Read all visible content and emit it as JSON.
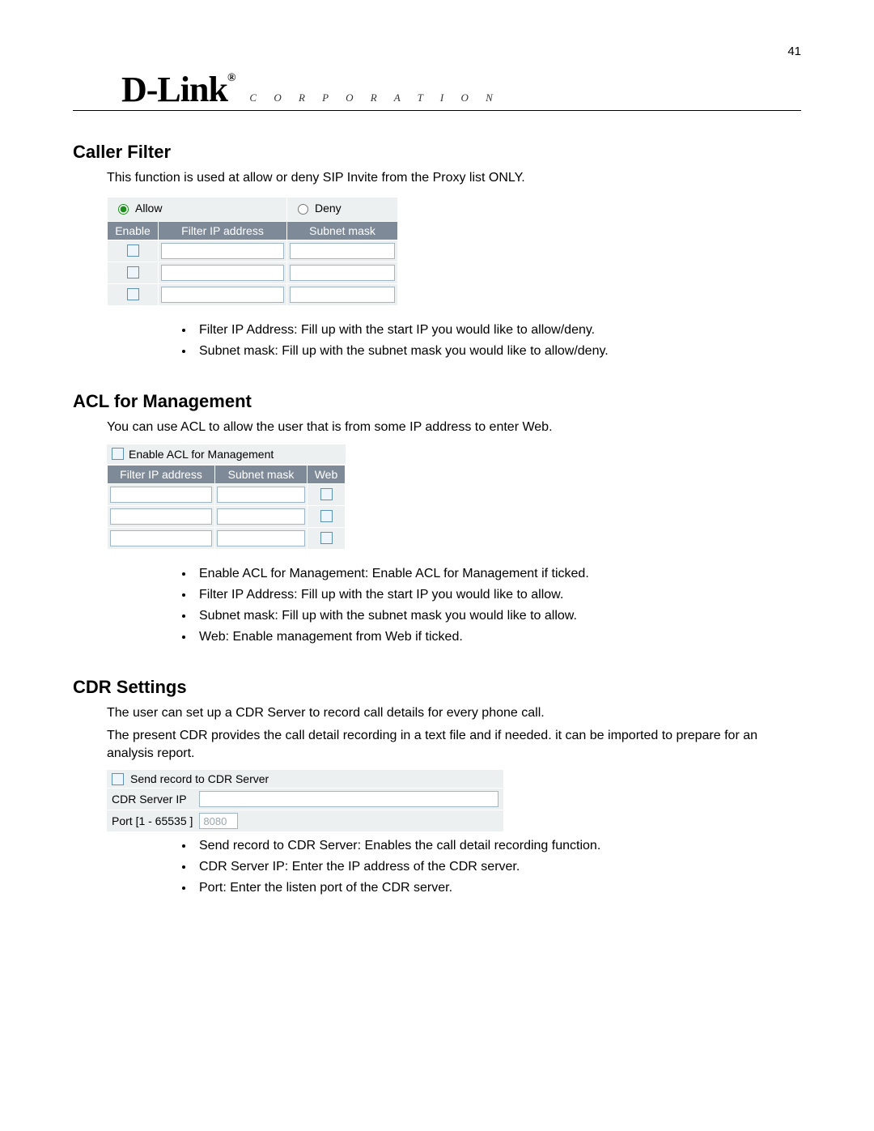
{
  "page_number": "41",
  "brand": {
    "name": "D-Link",
    "reg": "®",
    "tagline": "C O R P O R A T I O N"
  },
  "caller_filter": {
    "heading": "Caller Filter",
    "intro": "This function is used at allow or deny SIP Invite from the Proxy list ONLY.",
    "radio_allow": "Allow",
    "radio_deny": "Deny",
    "allow_selected": true,
    "col_enable": "Enable",
    "col_ip": "Filter IP address",
    "col_mask": "Subnet mask",
    "rows": [
      {
        "enable": false,
        "ip": "",
        "mask": ""
      },
      {
        "enable": false,
        "ip": "",
        "mask": ""
      },
      {
        "enable": false,
        "ip": "",
        "mask": ""
      }
    ],
    "bullets": [
      "Filter IP Address: Fill up with the start IP you would like to allow/deny.",
      "Subnet mask: Fill up with the subnet mask you would like to allow/deny."
    ]
  },
  "acl": {
    "heading": "ACL for Management",
    "intro": "You can use ACL to allow the user that is from some IP address to enter Web.",
    "enable_label": "Enable ACL for Management",
    "enable_checked": false,
    "col_ip": "Filter IP address",
    "col_mask": "Subnet mask",
    "col_web": "Web",
    "rows": [
      {
        "ip": "",
        "mask": "",
        "web": false
      },
      {
        "ip": "",
        "mask": "",
        "web": false
      },
      {
        "ip": "",
        "mask": "",
        "web": false
      }
    ],
    "bullets": [
      "Enable ACL for Management: Enable ACL for Management if ticked.",
      "Filter IP Address: Fill up with the start IP you would like to allow.",
      "Subnet mask: Fill up with the subnet mask you would like to allow.",
      "Web: Enable management from Web if ticked."
    ]
  },
  "cdr": {
    "heading": "CDR Settings",
    "intro1": "The user can set up a CDR Server to record call details for every phone call.",
    "intro2": "The present CDR provides the call detail recording in a text file and if needed. it can be imported to prepare for an analysis report.",
    "send_label": "Send record to CDR Server",
    "send_checked": false,
    "ip_label": "CDR Server IP",
    "ip_value": "",
    "port_label": "Port [1 - 65535 ]",
    "port_value": "8080",
    "bullets": [
      "Send record to CDR Server: Enables the call detail recording function.",
      "CDR Server IP: Enter the IP address of the CDR server.",
      "Port: Enter the listen port of the CDR server."
    ]
  }
}
